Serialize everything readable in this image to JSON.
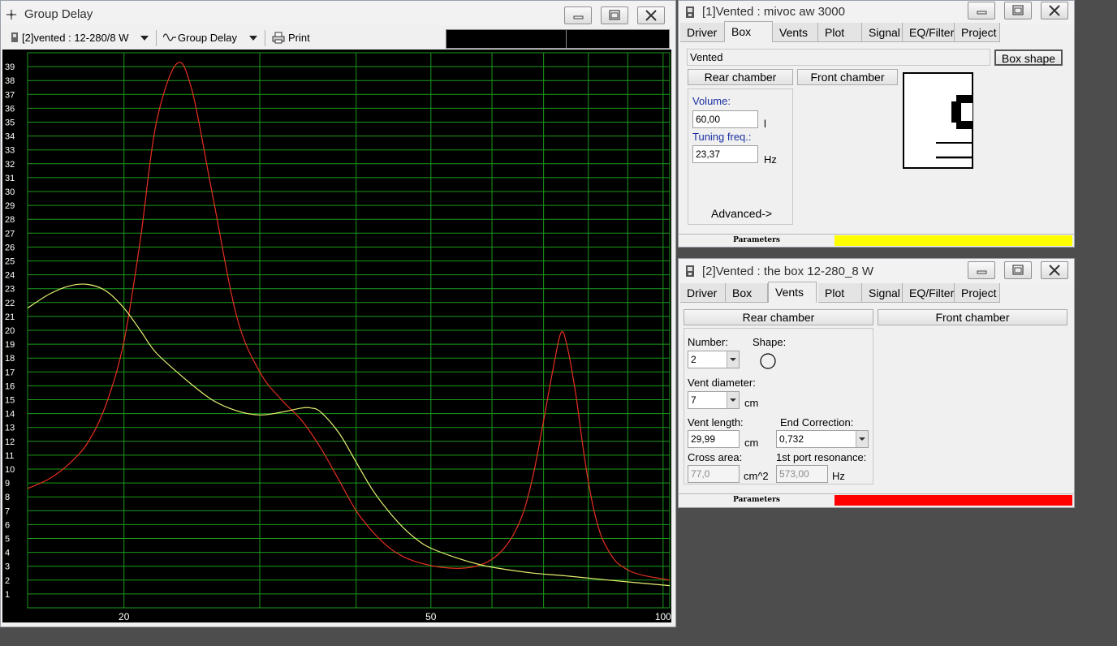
{
  "colors": {
    "curve_red": "#e83020",
    "curve_yellow": "#e8f070",
    "grid": "#1a9a1a",
    "status_yellow": "#ffff00",
    "status_red": "#ff0000"
  },
  "chart_window": {
    "title": "Group Delay",
    "icon": "crosshair-icon",
    "toolbar": {
      "project_select": "[2]vented : 12-280/8 W",
      "plot_select": "Group Delay",
      "print_label": "Print"
    }
  },
  "chart_data": {
    "type": "line",
    "title": "",
    "xlabel": "",
    "ylabel": "",
    "x_scale": "log",
    "xlim": [
      15,
      102
    ],
    "ylim": [
      0,
      40
    ],
    "grid": true,
    "y_ticks": [
      1,
      2,
      3,
      4,
      5,
      6,
      7,
      8,
      9,
      10,
      11,
      12,
      13,
      14,
      15,
      16,
      17,
      18,
      19,
      20,
      21,
      22,
      23,
      24,
      25,
      26,
      27,
      28,
      29,
      30,
      31,
      32,
      33,
      34,
      35,
      36,
      37,
      38,
      39
    ],
    "x_tick_labels": [
      {
        "value": 20,
        "label": "20"
      },
      {
        "value": 50,
        "label": "50"
      },
      {
        "value": 100,
        "label": "100"
      }
    ],
    "x_gridlines": [
      20,
      30,
      40,
      50,
      60,
      70,
      80,
      90,
      100
    ],
    "series": [
      {
        "color": "#e83020",
        "points": [
          [
            15,
            8.6
          ],
          [
            16,
            9.3
          ],
          [
            17,
            10.4
          ],
          [
            18,
            12.0
          ],
          [
            19,
            14.8
          ],
          [
            20,
            19.2
          ],
          [
            21,
            26.5
          ],
          [
            22,
            34.8
          ],
          [
            23.4,
            39.2
          ],
          [
            24.5,
            37.3
          ],
          [
            26,
            30.0
          ],
          [
            28,
            21.0
          ],
          [
            30,
            17.0
          ],
          [
            32,
            15.0
          ],
          [
            34,
            13.5
          ],
          [
            36,
            11.5
          ],
          [
            38,
            9.2
          ],
          [
            40,
            7.0
          ],
          [
            42,
            5.5
          ],
          [
            44,
            4.4
          ],
          [
            46,
            3.7
          ],
          [
            48,
            3.3
          ],
          [
            50,
            3.05
          ],
          [
            52,
            2.9
          ],
          [
            54,
            2.85
          ],
          [
            56,
            2.9
          ],
          [
            58,
            3.1
          ],
          [
            60,
            3.5
          ],
          [
            62,
            4.2
          ],
          [
            64,
            5.3
          ],
          [
            66,
            7.0
          ],
          [
            68,
            9.8
          ],
          [
            70,
            13.5
          ],
          [
            72,
            17.2
          ],
          [
            73.7,
            19.8
          ],
          [
            75,
            19.0
          ],
          [
            77,
            15.5
          ],
          [
            79,
            11.0
          ],
          [
            81,
            7.5
          ],
          [
            83,
            5.3
          ],
          [
            85,
            4.1
          ],
          [
            87,
            3.3
          ],
          [
            89,
            2.9
          ],
          [
            91,
            2.6
          ],
          [
            95,
            2.3
          ],
          [
            102,
            2.0
          ]
        ]
      },
      {
        "color": "#e8f070",
        "points": [
          [
            15,
            21.6
          ],
          [
            16,
            22.6
          ],
          [
            17,
            23.2
          ],
          [
            18,
            23.3
          ],
          [
            19,
            22.8
          ],
          [
            20,
            21.6
          ],
          [
            21,
            20.0
          ],
          [
            22,
            18.4
          ],
          [
            24,
            16.5
          ],
          [
            26,
            15.0
          ],
          [
            28,
            14.2
          ],
          [
            30,
            13.9
          ],
          [
            32,
            14.1
          ],
          [
            34,
            14.4
          ],
          [
            35,
            14.4
          ],
          [
            36,
            14.1
          ],
          [
            38,
            12.6
          ],
          [
            40,
            10.5
          ],
          [
            42,
            8.5
          ],
          [
            44,
            7.0
          ],
          [
            46,
            5.8
          ],
          [
            48,
            4.9
          ],
          [
            50,
            4.3
          ],
          [
            54,
            3.6
          ],
          [
            58,
            3.1
          ],
          [
            62,
            2.8
          ],
          [
            68,
            2.5
          ],
          [
            75,
            2.3
          ],
          [
            85,
            2.0
          ],
          [
            102,
            1.6
          ]
        ]
      }
    ]
  },
  "window1": {
    "title": "[1]Vented : mivoc aw 3000",
    "icon": "speaker-icon",
    "tabs": [
      "Driver",
      "Box",
      "Vents",
      "Plot",
      "Signal",
      "EQ/Filter",
      "Project"
    ],
    "active_tab": "Box",
    "box_type": "Vented",
    "box_shape_button": "Box shape",
    "rear_chamber": "Rear chamber",
    "front_chamber": "Front chamber",
    "volume_label": "Volume:",
    "volume_value": "60,00",
    "volume_unit": "l",
    "tuning_label": "Tuning freq.:",
    "tuning_value": "23,37",
    "tuning_unit": "Hz",
    "advanced_label": "Advanced->",
    "status_label": "Parameters"
  },
  "window2": {
    "title": "[2]Vented : the box 12-280_8 W",
    "icon": "speaker-icon",
    "tabs": [
      "Driver",
      "Box",
      "Vents",
      "Plot",
      "Signal",
      "EQ/Filter",
      "Project"
    ],
    "active_tab": "Vents",
    "rear_chamber": "Rear chamber",
    "front_chamber": "Front chamber",
    "number_label": "Number:",
    "number_value": "2",
    "shape_label": "Shape:",
    "shape_icon": "circle-shape-icon",
    "diameter_label": "Vent diameter:",
    "diameter_value": "7",
    "diameter_unit": "cm",
    "length_label": "Vent length:",
    "length_value": "29,99",
    "length_unit": "cm",
    "end_correction_label": "End Correction:",
    "end_correction_value": "0,732",
    "cross_area_label": "Cross area:",
    "cross_area_value": "77,0",
    "cross_area_unit": "cm^2",
    "port_resonance_label": "1st port resonance:",
    "port_resonance_value": "573,00",
    "port_resonance_unit": "Hz",
    "status_label": "Parameters"
  }
}
